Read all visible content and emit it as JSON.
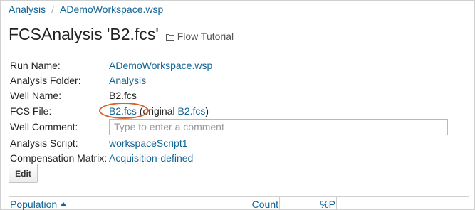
{
  "breadcrumb": {
    "items": [
      "Analysis",
      "ADemoWorkspace.wsp"
    ],
    "separator": "/"
  },
  "page": {
    "title": "FCSAnalysis 'B2.fcs'",
    "folder_label": "Flow Tutorial",
    "folder_icon": "folder-icon"
  },
  "properties": {
    "run_name": {
      "label": "Run Name:",
      "value": "ADemoWorkspace.wsp"
    },
    "analysis_folder": {
      "label": "Analysis Folder:",
      "value": "Analysis"
    },
    "well_name": {
      "label": "Well Name:",
      "value": "B2.fcs"
    },
    "fcs_file": {
      "label": "FCS File:",
      "value": "B2.fcs",
      "original_prefix": "(original ",
      "original_value": "B2.fcs",
      "original_suffix": ")"
    },
    "well_comment": {
      "label": "Well Comment:",
      "placeholder": "Type to enter a comment",
      "value": ""
    },
    "analysis_script": {
      "label": "Analysis Script:",
      "value": "workspaceScript1"
    },
    "compensation_matrix": {
      "label": "Compensation Matrix:",
      "value": "Acquisition-defined"
    }
  },
  "buttons": {
    "edit_label": "Edit"
  },
  "grid": {
    "columns": [
      "Population",
      "Count",
      "%P"
    ],
    "sort_column": "Population",
    "sort_direction": "ascending"
  },
  "colors": {
    "link": "#126495",
    "highlight_circle": "#d9602a",
    "text": "#222222"
  }
}
